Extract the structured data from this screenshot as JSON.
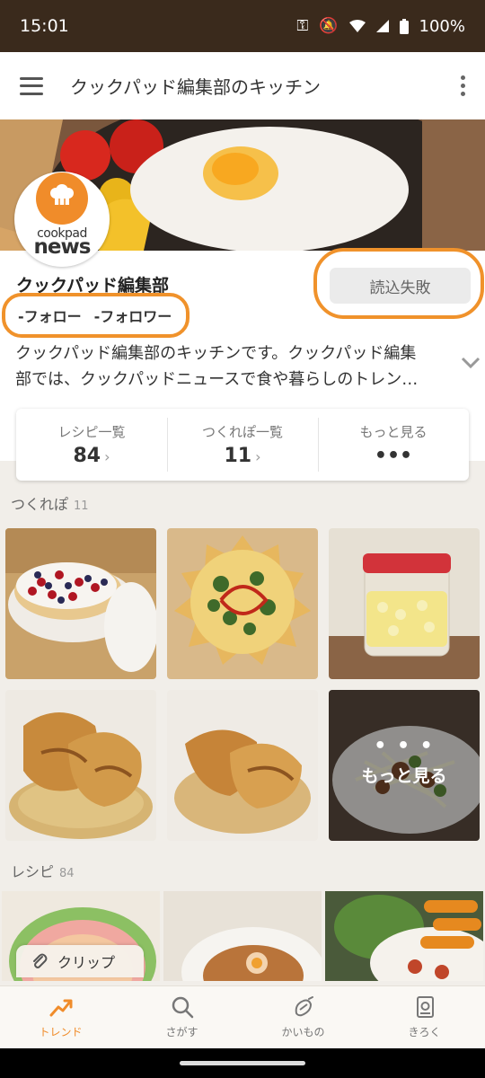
{
  "status_bar": {
    "time": "15:01",
    "battery": "100%"
  },
  "app_bar": {
    "title": "クックパッド編集部のキッチン"
  },
  "profile": {
    "brand_logo_line1": "cookpad",
    "brand_logo_line2": "news",
    "name": "クックパッド編集部",
    "follow_label": "-フォロー",
    "follower_label": "-フォロワー",
    "load_button": "読込失敗",
    "description_line1": "クックパッド編集部のキッチンです。クックパッド編集",
    "description_line2": "部では、クックパッドニュースで食や暮らしのトレン…"
  },
  "stats": [
    {
      "label": "レシピ一覧",
      "value": "84",
      "chevron": "›"
    },
    {
      "label": "つくれぽ一覧",
      "value": "11",
      "chevron": "›"
    },
    {
      "label": "もっと見る",
      "value": "•••",
      "chevron": ""
    }
  ],
  "tsukurepo": {
    "title": "つくれぽ",
    "count": "11",
    "more_dots": "• • •",
    "more_label": "もっと見る"
  },
  "recipes": {
    "title": "レシピ",
    "count": "84",
    "clip_label": "クリップ"
  },
  "bottom_nav": [
    {
      "label": "トレンド",
      "icon": "trend-icon",
      "active": true
    },
    {
      "label": "さがす",
      "icon": "search-icon",
      "active": false
    },
    {
      "label": "かいもの",
      "icon": "shopping-icon",
      "active": false
    },
    {
      "label": "きろく",
      "icon": "record-icon",
      "active": false
    }
  ],
  "colors": {
    "accent": "#f08c2a",
    "status_bar": "#3a2a1c",
    "background": "#f1eee9"
  }
}
